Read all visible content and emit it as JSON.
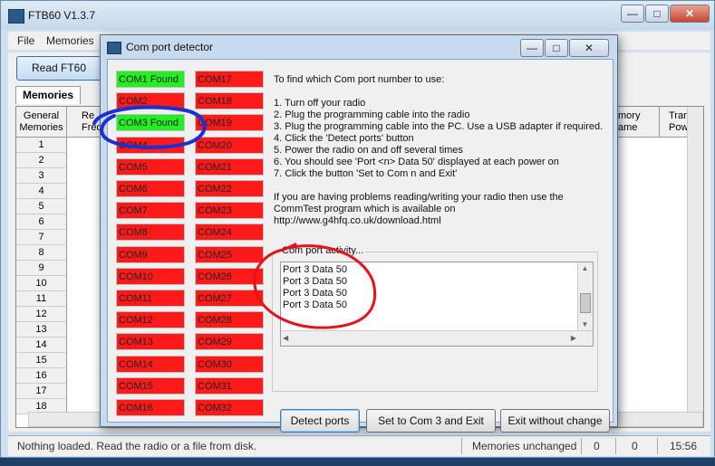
{
  "main": {
    "title": "FTB60 V1.3.7",
    "menu": [
      "File",
      "Memories"
    ],
    "read_button": "Read FT60",
    "tab": "Memories",
    "headers": {
      "general": "General\nMemories",
      "freq_partial": "Re\nFreq",
      "memory_name_partial": "mory\name",
      "trans_power_partial": "Trans\nPow"
    },
    "rows": [
      "1",
      "2",
      "3",
      "4",
      "5",
      "6",
      "7",
      "8",
      "9",
      "10",
      "11",
      "12",
      "13",
      "14",
      "15",
      "16",
      "17",
      "18"
    ],
    "status": {
      "message": "Nothing loaded. Read the radio or a file from disk.",
      "memories": "Memories unchanged",
      "count1": "0",
      "count2": "0",
      "time": "15:56"
    }
  },
  "dialog": {
    "title": "Com port detector",
    "ports_col1": [
      {
        "label": "COM1 Found",
        "found": true
      },
      {
        "label": "COM2",
        "found": false
      },
      {
        "label": "COM3 Found",
        "found": true
      },
      {
        "label": "COM4",
        "found": false
      },
      {
        "label": "COM5",
        "found": false
      },
      {
        "label": "COM6",
        "found": false
      },
      {
        "label": "COM7",
        "found": false
      },
      {
        "label": "COM8",
        "found": false
      },
      {
        "label": "COM9",
        "found": false
      },
      {
        "label": "COM10",
        "found": false
      },
      {
        "label": "COM11",
        "found": false
      },
      {
        "label": "COM12",
        "found": false
      },
      {
        "label": "COM13",
        "found": false
      },
      {
        "label": "COM14",
        "found": false
      },
      {
        "label": "COM15",
        "found": false
      },
      {
        "label": "COM16",
        "found": false
      }
    ],
    "ports_col2": [
      {
        "label": "COM17",
        "found": false
      },
      {
        "label": "COM18",
        "found": false
      },
      {
        "label": "COM19",
        "found": false
      },
      {
        "label": "COM20",
        "found": false
      },
      {
        "label": "COM21",
        "found": false
      },
      {
        "label": "COM22",
        "found": false
      },
      {
        "label": "COM23",
        "found": false
      },
      {
        "label": "COM24",
        "found": false
      },
      {
        "label": "COM25",
        "found": false
      },
      {
        "label": "COM26",
        "found": false
      },
      {
        "label": "COM27",
        "found": false
      },
      {
        "label": "COM28",
        "found": false
      },
      {
        "label": "COM29",
        "found": false
      },
      {
        "label": "COM30",
        "found": false
      },
      {
        "label": "COM31",
        "found": false
      },
      {
        "label": "COM32",
        "found": false
      }
    ],
    "instructions": [
      "To find which Com port number to use:",
      "",
      "1. Turn off your radio",
      "2. Plug the programming cable into the radio",
      "3. Plug the programming cable into the PC. Use a USB adapter if required.",
      "4. Click the 'Detect ports' button",
      "5. Power the radio on and off several times",
      "6. You should see 'Port <n> Data 50' displayed at each power on",
      "7. Click the button 'Set to Com n and Exit'",
      "",
      "If you are having problems reading/writing your radio then use the",
      "CommTest program which is available on",
      "http://www.g4hfq.co.uk/download.html"
    ],
    "activity_label": "Com port activity...",
    "activity_lines": [
      "Port 3 Data 50",
      "Port 3 Data 50",
      "Port 3 Data 50",
      "Port 3 Data 50"
    ],
    "buttons": {
      "detect": "Detect ports",
      "set_exit": "Set to Com 3 and Exit",
      "exit_no_change": "Exit without change"
    }
  },
  "colors": {
    "port_not_found": "#ff1a1a",
    "port_found": "#22ee22",
    "annotation_blue": "#1a2fd6",
    "annotation_red": "#e8101a"
  }
}
